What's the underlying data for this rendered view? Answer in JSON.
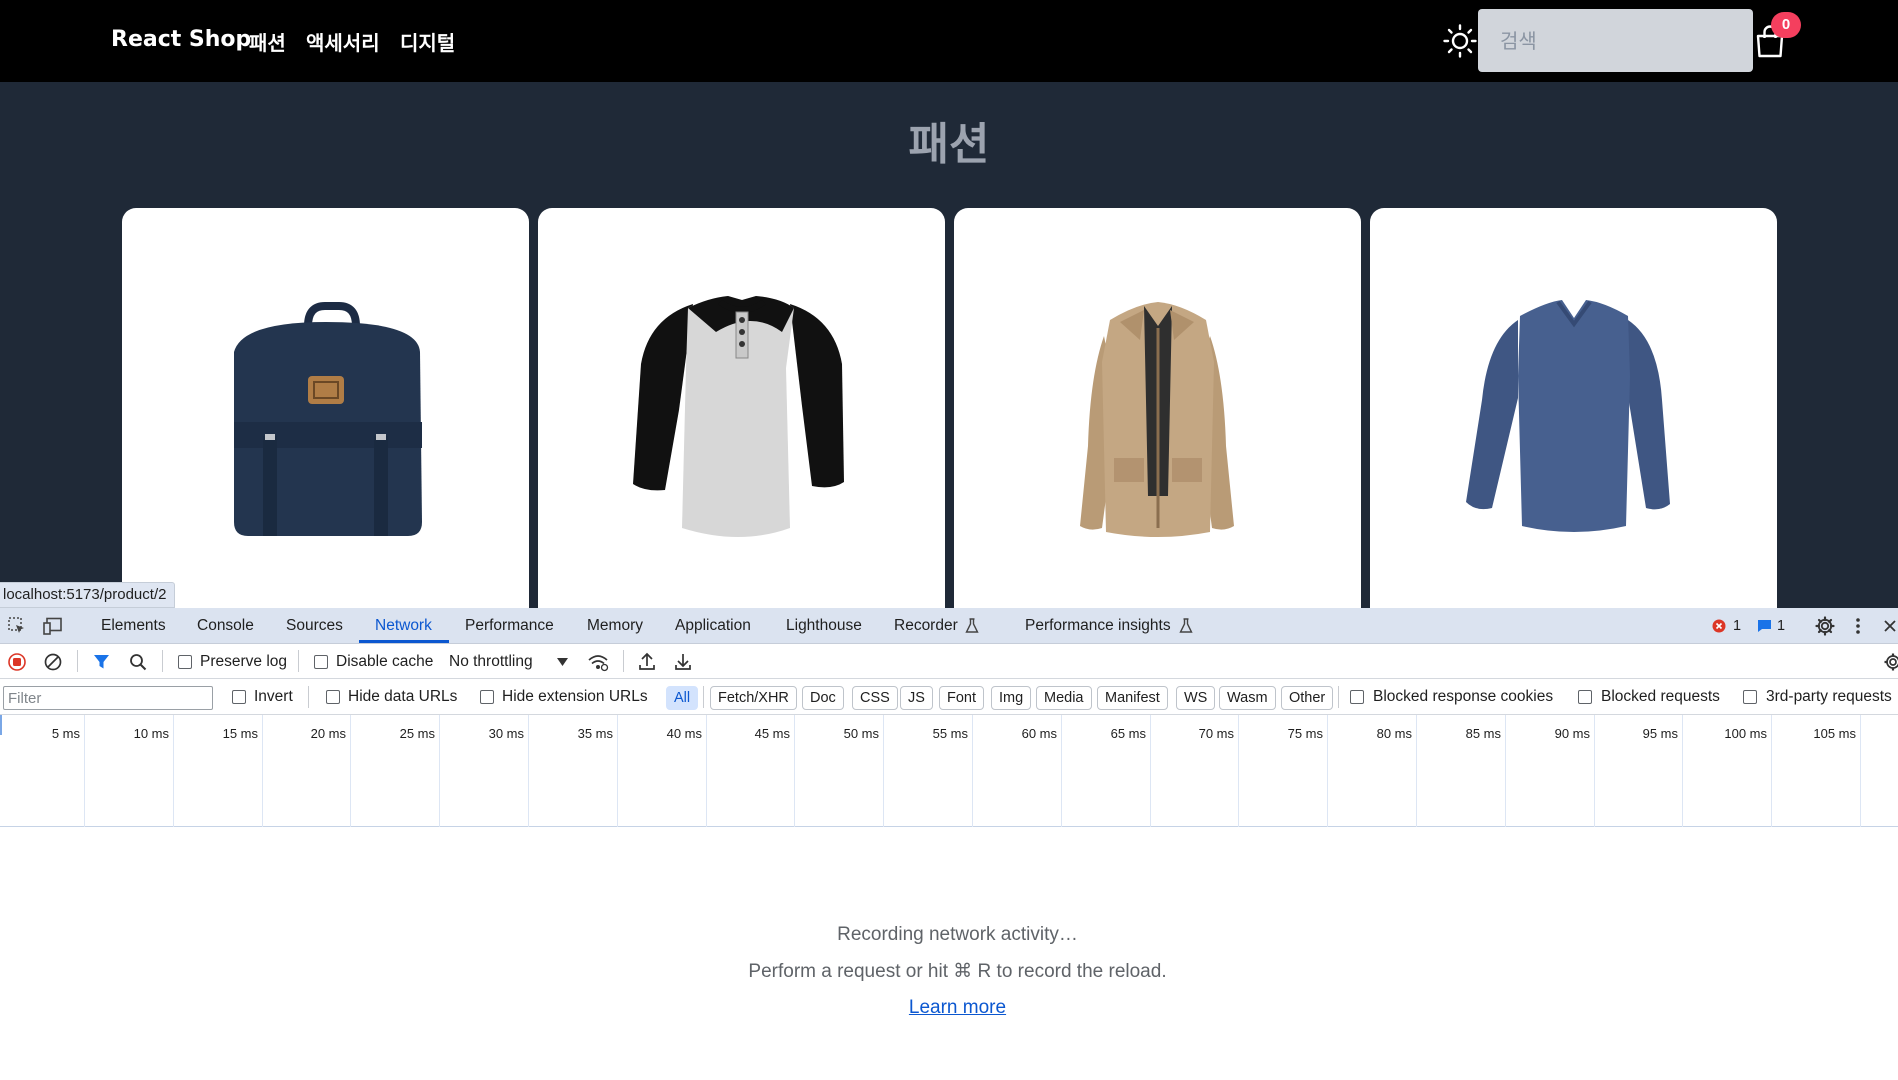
{
  "site": {
    "brand": "React Shop",
    "nav": [
      "패션",
      "액세서리",
      "디지털"
    ],
    "search_placeholder": "검색",
    "cart_count": "0",
    "section_title": "패션",
    "products": [
      "backpack-image",
      "raglan-henley-shirt-image",
      "khaki-jacket-image",
      "blue-long-sleeve-tee-image"
    ],
    "status_url": "localhost:5173/product/2"
  },
  "devtools": {
    "tabs": [
      "Elements",
      "Console",
      "Sources",
      "Network",
      "Performance",
      "Memory",
      "Application",
      "Lighthouse",
      "Recorder",
      "Performance insights"
    ],
    "active_tab": "Network",
    "error_count": "1",
    "message_count": "1",
    "toolbar": {
      "preserve_log": "Preserve log",
      "disable_cache": "Disable cache",
      "throttling": "No throttling"
    },
    "filter": {
      "placeholder": "Filter",
      "invert": "Invert",
      "hide_data_urls": "Hide data URLs",
      "hide_extension_urls": "Hide extension URLs",
      "types": [
        "All",
        "Fetch/XHR",
        "Doc",
        "CSS",
        "JS",
        "Font",
        "Img",
        "Media",
        "Manifest",
        "WS",
        "Wasm",
        "Other"
      ],
      "blocked_response_cookies": "Blocked response cookies",
      "blocked_requests": "Blocked requests",
      "third_party": "3rd-party requests"
    },
    "timeline_ticks": [
      "5 ms",
      "10 ms",
      "15 ms",
      "20 ms",
      "25 ms",
      "30 ms",
      "35 ms",
      "40 ms",
      "45 ms",
      "50 ms",
      "55 ms",
      "60 ms",
      "65 ms",
      "70 ms",
      "75 ms",
      "80 ms",
      "85 ms",
      "90 ms",
      "95 ms",
      "100 ms",
      "105 ms"
    ],
    "empty": {
      "recording": "Recording network activity…",
      "hint": "Perform a request or hit ⌘ R to record the reload.",
      "learn_more": "Learn more"
    }
  },
  "colors": {
    "site_bg": "#1f2937",
    "nav_bg": "#000000",
    "badge": "#f43f5e",
    "devtools_accent": "#0b57d0"
  }
}
